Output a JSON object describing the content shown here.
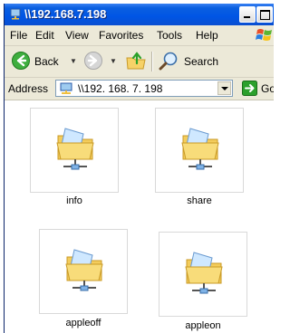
{
  "window": {
    "title": "\\\\192.168.7.198",
    "title_icon": "network-folder-icon"
  },
  "menubar": {
    "items": [
      "File",
      "Edit",
      "View",
      "Favorites",
      "Tools",
      "Help"
    ]
  },
  "toolbar": {
    "back_label": "Back",
    "search_label": "Search"
  },
  "address": {
    "label": "Address",
    "value": "\\\\192. 168. 7. 198",
    "go_label": "Go"
  },
  "folders": [
    {
      "name": "info",
      "icon": "shared-network-folder-icon"
    },
    {
      "name": "share",
      "icon": "shared-network-folder-icon"
    },
    {
      "name": "appleoff",
      "icon": "shared-network-folder-icon"
    },
    {
      "name": "appleon",
      "icon": "shared-network-folder-icon"
    }
  ],
  "colors": {
    "titlebar": "#0055e5",
    "chrome": "#ece9d8",
    "go_green": "#2ca02c"
  }
}
